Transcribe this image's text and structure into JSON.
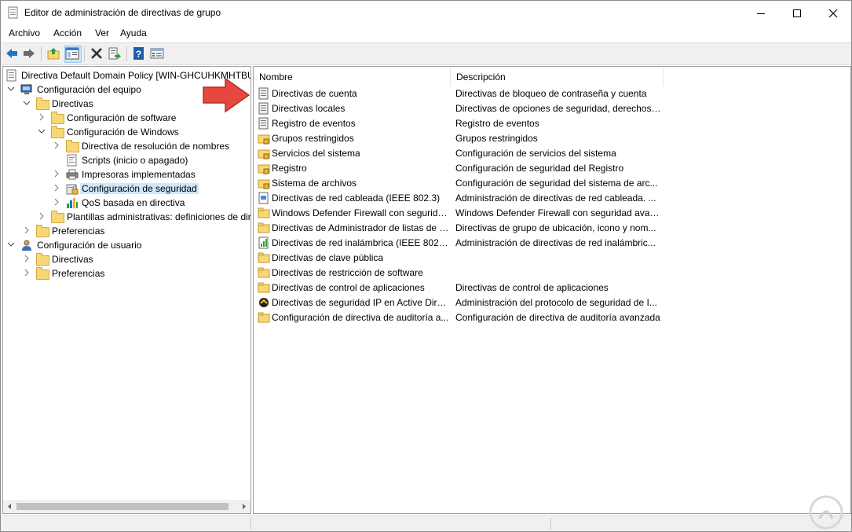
{
  "window": {
    "title": "Editor de administración de directivas de grupo",
    "accent": "#cce8ff"
  },
  "menu": [
    "Archivo",
    "Acción",
    "Ver",
    "Ayuda"
  ],
  "toolbar_icons": [
    "back-icon",
    "forward-icon",
    "up-folder-icon",
    "show-hide-tree-icon",
    "delete-icon",
    "export-list-icon",
    "help-icon",
    "properties-icon"
  ],
  "tree": [
    {
      "label": "Directiva Default Domain Policy [WIN-GHCUHKMHTBU",
      "icon": "policy-icon"
    },
    {
      "label": "Configuración del equipo",
      "icon": "computer-icon"
    },
    {
      "label": "Directivas",
      "icon": "folder-icon"
    },
    {
      "label": "Configuración de software",
      "icon": "folder-icon"
    },
    {
      "label": "Configuración de Windows",
      "icon": "folder-icon"
    },
    {
      "label": "Directiva de resolución de nombres",
      "icon": "folder-icon"
    },
    {
      "label": "Scripts (inicio o apagado)",
      "icon": "script-icon"
    },
    {
      "label": "Impresoras implementadas",
      "icon": "printer-icon"
    },
    {
      "label": "Configuración de seguridad",
      "icon": "security-icon",
      "selected": true
    },
    {
      "label": "QoS basada en directiva",
      "icon": "chart-icon"
    },
    {
      "label": "Plantillas administrativas: definiciones de dir",
      "icon": "folder-icon"
    },
    {
      "label": "Preferencias",
      "icon": "folder-icon"
    },
    {
      "label": "Configuración de usuario",
      "icon": "user-icon"
    },
    {
      "label": "Directivas",
      "icon": "folder-icon"
    },
    {
      "label": "Preferencias",
      "icon": "folder-icon"
    }
  ],
  "list": {
    "columns": [
      "Nombre",
      "Descripción"
    ],
    "rows": [
      {
        "name": "Directivas de cuenta",
        "desc": "Directivas de bloqueo de contraseña y cuenta",
        "icon": "policy-book-icon"
      },
      {
        "name": "Directivas locales",
        "desc": "Directivas de opciones de seguridad, derechos ...",
        "icon": "policy-book-icon"
      },
      {
        "name": "Registro de eventos",
        "desc": "Registro de eventos",
        "icon": "policy-book-icon"
      },
      {
        "name": "Grupos restringidos",
        "desc": "Grupos restringidos",
        "icon": "locked-folder-icon"
      },
      {
        "name": "Servicios del sistema",
        "desc": "Configuración de servicios del sistema",
        "icon": "locked-folder-icon"
      },
      {
        "name": "Registro",
        "desc": "Configuración de seguridad del Registro",
        "icon": "locked-folder-icon"
      },
      {
        "name": "Sistema de archivos",
        "desc": "Configuración de seguridad del sistema de arc...",
        "icon": "locked-folder-icon"
      },
      {
        "name": "Directivas de red cableada (IEEE 802.3)",
        "desc": "Administración de directivas de red cableada. ...",
        "icon": "network-icon"
      },
      {
        "name": "Windows Defender Firewall con segurida...",
        "desc": "Windows Defender Firewall con seguridad avan...",
        "icon": "folder-icon"
      },
      {
        "name": "Directivas de Administrador de listas de r...",
        "desc": "Directivas de grupo de ubicación, icono y nom...",
        "icon": "folder-icon"
      },
      {
        "name": "Directivas de red inalámbrica (IEEE 802.11)",
        "desc": "Administración de directivas de red inalámbric...",
        "icon": "wireless-icon"
      },
      {
        "name": "Directivas de clave pública",
        "desc": "",
        "icon": "folder-icon"
      },
      {
        "name": "Directivas de restricción de software",
        "desc": "",
        "icon": "folder-icon"
      },
      {
        "name": "Directivas de control de aplicaciones",
        "desc": "Directivas de control de aplicaciones",
        "icon": "folder-icon"
      },
      {
        "name": "Directivas de seguridad IP en Active Direc...",
        "desc": "Administración del protocolo de seguridad de I...",
        "icon": "ipsec-icon"
      },
      {
        "name": "Configuración de directiva de auditoría a...",
        "desc": "Configuración de directiva de auditoría avanzada",
        "icon": "folder-icon"
      }
    ]
  }
}
